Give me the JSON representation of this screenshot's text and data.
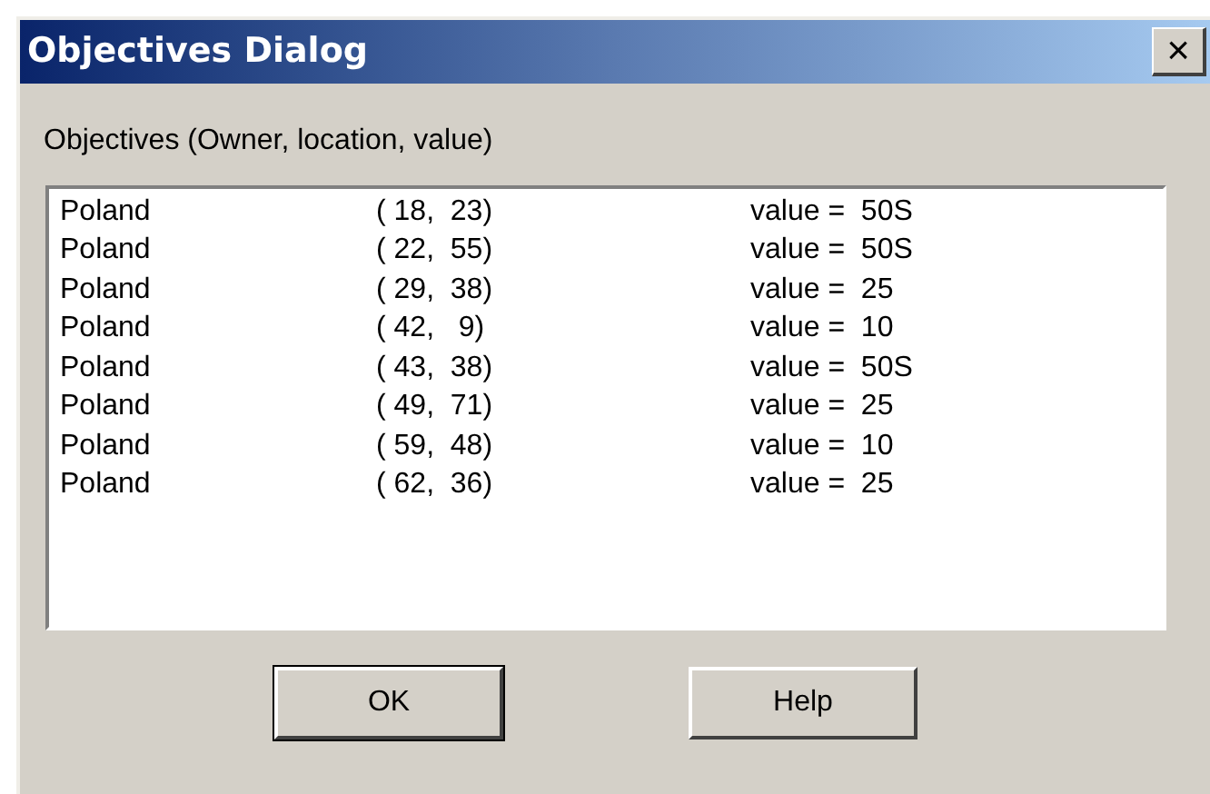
{
  "window": {
    "title": "Objectives Dialog",
    "close": "×"
  },
  "list_label": "Objectives (Owner, location, value)",
  "objectives": [
    {
      "owner": "Poland",
      "location": "( 18,  23)",
      "value": "value =  50S"
    },
    {
      "owner": "Poland",
      "location": "( 22,  55)",
      "value": "value =  50S"
    },
    {
      "owner": "Poland",
      "location": "( 29,  38)",
      "value": "value =  25"
    },
    {
      "owner": "Poland",
      "location": "( 42,   9)",
      "value": "value =  10"
    },
    {
      "owner": "Poland",
      "location": "( 43,  38)",
      "value": "value =  50S"
    },
    {
      "owner": "Poland",
      "location": "( 49,  71)",
      "value": "value =  25"
    },
    {
      "owner": "Poland",
      "location": "( 59,  48)",
      "value": "value =  10"
    },
    {
      "owner": "Poland",
      "location": "( 62,  36)",
      "value": "value =  25"
    }
  ],
  "buttons": [
    "OK",
    "Help"
  ]
}
